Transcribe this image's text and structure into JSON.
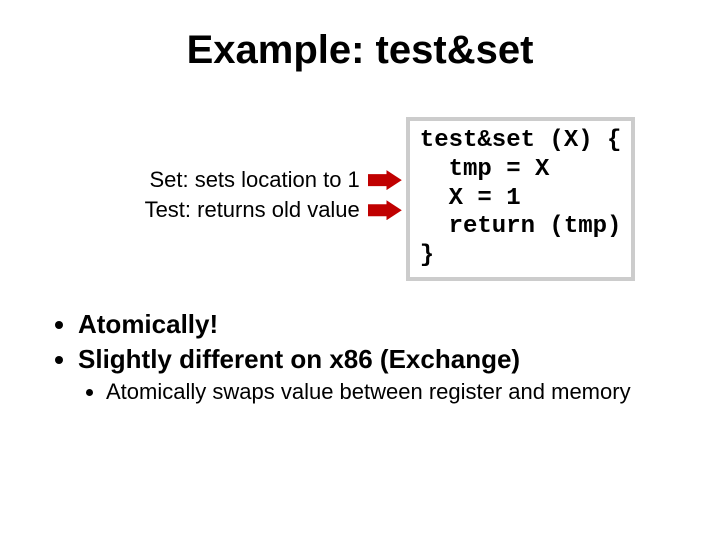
{
  "title": "Example: test&set",
  "annotations": {
    "set": "Set: sets location to 1",
    "test": "Test: returns old value"
  },
  "code": {
    "l1": "test&set (X) {",
    "l2": "  tmp = X",
    "l3": "  X = 1",
    "l4": "  return (tmp)",
    "l5": "}"
  },
  "bullets": {
    "b1": "Atomically!",
    "b2": "Slightly different on x86 (Exchange)",
    "sub1": "Atomically swaps value between register and memory"
  }
}
